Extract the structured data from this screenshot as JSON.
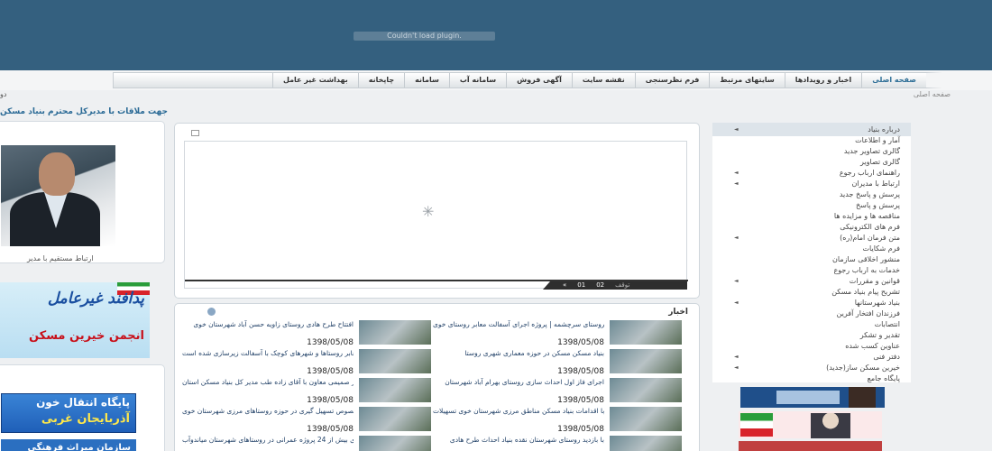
{
  "header": {
    "plugin_message": "Couldn't load plugin."
  },
  "nav": {
    "items": [
      {
        "label": "صفحه اصلی",
        "home": true
      },
      {
        "label": "اخبار و رویدادها"
      },
      {
        "label": "سایتهای مرتبط"
      },
      {
        "label": "فرم نظرسنجی"
      },
      {
        "label": "نقشه سایت"
      },
      {
        "label": "آگهی فروش"
      },
      {
        "label": "سامانه آب"
      },
      {
        "label": "سامانه"
      },
      {
        "label": "چاپخانه"
      },
      {
        "label": "بهداشت غیر عامل"
      }
    ]
  },
  "breadcrumb": {
    "right": "صفحه اصلی",
    "left": "دو"
  },
  "marquee": "جهت ملاقات با مدیرکل محترم بنیاد مسکن",
  "left": {
    "photo_caption": "ارتباط مستقیم با مدیر",
    "banner1_line1": "پدافند غیرعامل",
    "banner1_line2": "انجمن خیرین مسکن",
    "banner2_line1": "پایگاه انتقال خون",
    "banner2_line2": "آذربایجان غربی",
    "banner3": "سازمان میراث فرهنگی"
  },
  "slider": {
    "spinner": "✳",
    "controls": [
      "توقف",
      "02",
      "01",
      "«"
    ]
  },
  "news": {
    "title": "اخبار",
    "items": [
      {
        "text": "بازدید از اجرای طرح هادی روستای سرچشمه | پروژه اجرای آسفالت معابر روستای خوی",
        "date": "1398/05/08"
      },
      {
        "text": "افتتاح طرح هادی روستای زاویه حسن آباد شهرستان خوی",
        "date": "1398/05/08"
      },
      {
        "text": "بنیاد مسکن مسکن در حوزه معماری شهری روستا",
        "date": "1398/05/08"
      },
      {
        "text": "بیش از 85 میلیون متر مربع از معابر روستاها و شهرهای کوچک با آسفالت زیرسازی شده است",
        "date": "1398/05/08"
      },
      {
        "text": "اجرای فاز اول احداث سازی روستای بهرام آباد شهرستان",
        "date": "1398/05/08"
      },
      {
        "text": "دیدار صمیمی معاون با آقای زاده طب مدیر کل بنیاد مسکن استان",
        "date": "1398/05/08"
      },
      {
        "text": "با اقدامات بنیاد مسکن مناطق مرزی شهرستان خوی تسهیلات",
        "date": "1398/05/08"
      },
      {
        "text": "نشست در خصوص تسهیل گیری در حوزه روستاهای مرزی شهرستان خوی",
        "date": "1398/05/08"
      },
      {
        "text": "با بازدید روستای شهرستان نقده بنیاد احداث طرح هادی",
        "date": "1398/05/08"
      },
      {
        "text": "اجرای بیش از 24 پروژه عمرانی در روستاهای شهرستان میاندوآب",
        "date": "1398/05/08"
      }
    ]
  },
  "menu": {
    "items": [
      {
        "label": "درباره بنیاد",
        "arrow": true
      },
      {
        "label": "آمار و اطلاعات"
      },
      {
        "label": "گالری تصاویر جدید"
      },
      {
        "label": "گالری تصاویر"
      },
      {
        "label": "راهنمای ارباب رجوع",
        "arrow": true
      },
      {
        "label": "ارتباط با مدیران",
        "arrow": true
      },
      {
        "label": "پرسش و پاسخ جدید"
      },
      {
        "label": "پرسش و پاسخ"
      },
      {
        "label": "مناقصه ها و مزایده ها"
      },
      {
        "label": "فرم های الکترونیکی"
      },
      {
        "label": "(متن فرمان امام(ره",
        "arrow": true
      },
      {
        "label": "فرم شکایات"
      },
      {
        "label": "منشور اخلاقی سازمان"
      },
      {
        "label": "خدمات به ارباب رجوع"
      },
      {
        "label": "قوانین و مقررات",
        "arrow": true
      },
      {
        "label": "تشریح پیام بنیاد مسکن"
      },
      {
        "label": "بنیاد شهرستانها",
        "arrow": true
      },
      {
        "label": "فرزندان افتخار آفرین"
      },
      {
        "label": "انتصابات"
      },
      {
        "label": "تقدیر و تشکر"
      },
      {
        "label": "عناوین کسب شده"
      },
      {
        "label": "دفتر فنی",
        "arrow": true
      },
      {
        "label": "(خیرین مسکن ساز(جدید",
        "arrow": true
      },
      {
        "label": "پایگاه جامع"
      }
    ]
  }
}
